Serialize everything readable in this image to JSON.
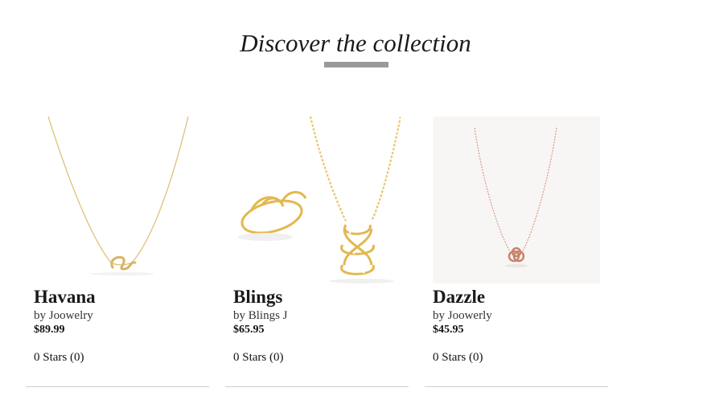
{
  "section": {
    "heading": "Discover the collection"
  },
  "products": [
    {
      "name": "Havana",
      "brand": "by Joowelry",
      "price": "$89.99",
      "rating": "0 Stars (0)",
      "image": "gold-snake-pendant-necklace"
    },
    {
      "name": "Blings",
      "brand": "by Blings J",
      "price": "$65.95",
      "rating": "0 Stars (0)",
      "image": "gold-diamond-ring-and-pendant"
    },
    {
      "name": "Dazzle",
      "brand": "by Joowerly",
      "price": "$45.95",
      "rating": "0 Stars (0)",
      "image": "rose-gold-knot-necklace"
    }
  ],
  "colors": {
    "underline": "#9a9a9a",
    "divider": "#cfcfcf",
    "gold": "#e2c07a",
    "rose_gold": "#d49a85"
  }
}
